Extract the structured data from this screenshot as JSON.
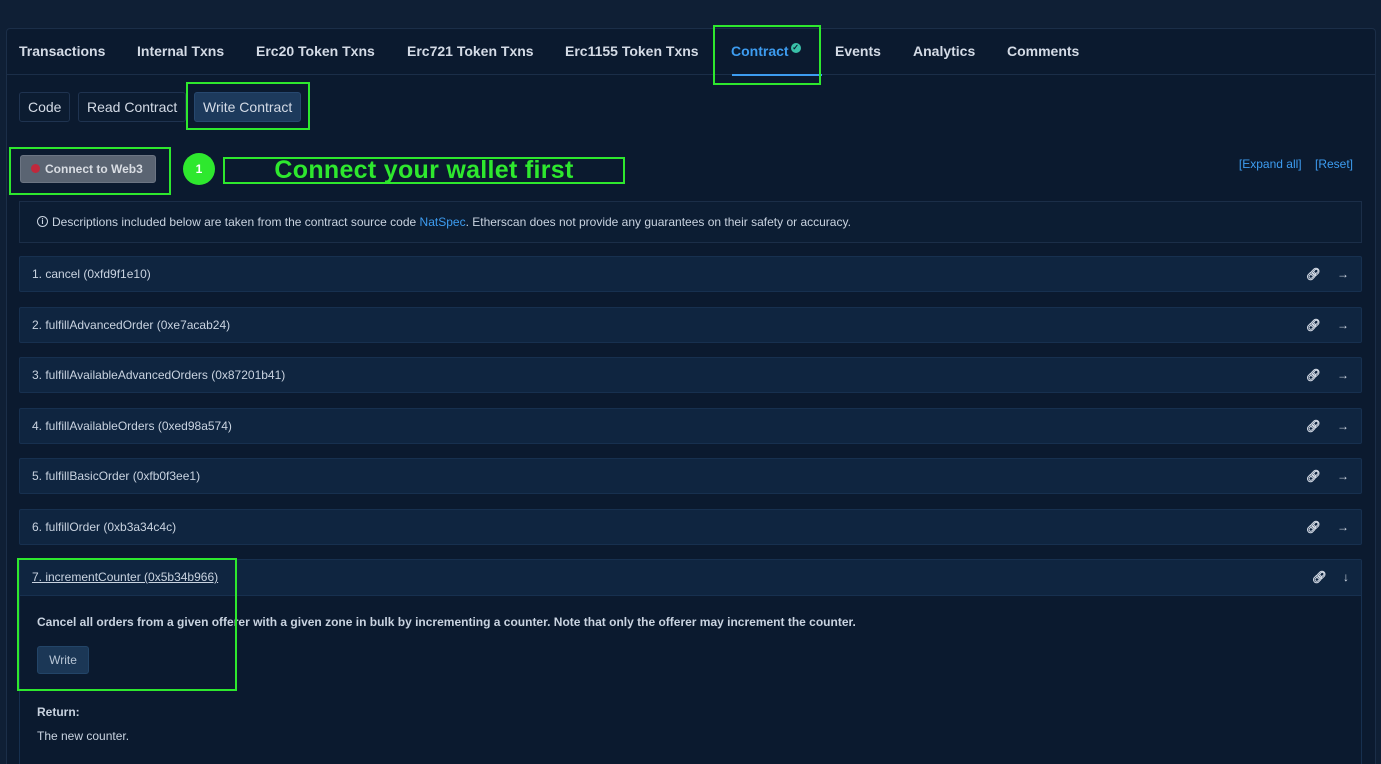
{
  "tabs": [
    {
      "label": "Transactions"
    },
    {
      "label": "Internal Txns"
    },
    {
      "label": "Erc20 Token Txns"
    },
    {
      "label": "Erc721 Token Txns"
    },
    {
      "label": "Erc1155 Token Txns"
    },
    {
      "label": "Contract",
      "verified_icon": "check-circle-icon"
    },
    {
      "label": "Events"
    },
    {
      "label": "Analytics"
    },
    {
      "label": "Comments"
    }
  ],
  "active_tab": "Contract",
  "subtabs": [
    {
      "label": "Code"
    },
    {
      "label": "Read Contract"
    },
    {
      "label": "Write Contract"
    }
  ],
  "active_subtab": "Write Contract",
  "connect": {
    "button_label": "Connect to Web3",
    "step_number": "1",
    "hint": "Connect your wallet first"
  },
  "links": {
    "expand_all": "[Expand all]",
    "reset": "[Reset]"
  },
  "notice": {
    "prefix": "Descriptions included below are taken from the contract source code",
    "link": "NatSpec",
    "suffix": ". Etherscan does not provide any guarantees on their safety or accuracy."
  },
  "functions": [
    {
      "label": "1. cancel (0xfd9f1e10)"
    },
    {
      "label": "2. fulfillAdvancedOrder (0xe7acab24)"
    },
    {
      "label": "3. fulfillAvailableAdvancedOrders (0x87201b41)"
    },
    {
      "label": "4. fulfillAvailableOrders (0xed98a574)"
    },
    {
      "label": "5. fulfillBasicOrder (0xfb0f3ee1)"
    },
    {
      "label": "6. fulfillOrder (0xb3a34c4c)"
    }
  ],
  "expanded_function": {
    "label": "7. incrementCounter (0x5b34b966)",
    "description": "Cancel all orders from a given offerer with a given zone in bulk by incrementing a counter. Note that only the offerer may increment the counter.",
    "write_label": "Write",
    "return_label": "Return:",
    "return_value": "The new counter."
  },
  "colors": {
    "accent": "#3d9cf0",
    "highlight": "#2ee82e",
    "background": "#0b1a2f"
  }
}
